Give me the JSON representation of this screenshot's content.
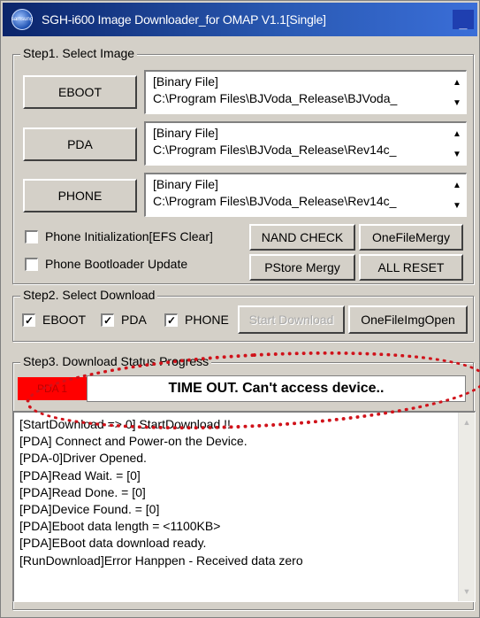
{
  "window": {
    "title": "SGH-i600 Image Downloader_for OMAP V1.1[Single]",
    "minimize_label": "_",
    "icon_text": "samsung"
  },
  "step1": {
    "title": "Step1. Select Image",
    "rows": [
      {
        "button": "EBOOT",
        "line1": "[Binary File]",
        "line2": "C:\\Program Files\\BJVoda_Release\\BJVoda_"
      },
      {
        "button": "PDA",
        "line1": "[Binary File]",
        "line2": "C:\\Program Files\\BJVoda_Release\\Rev14c_"
      },
      {
        "button": "PHONE",
        "line1": "[Binary File]",
        "line2": "C:\\Program Files\\BJVoda_Release\\Rev14c_"
      }
    ],
    "phone_init_label": "Phone Initialization[EFS Clear]",
    "phone_boot_label": "Phone Bootloader Update",
    "nand_check": "NAND CHECK",
    "onefile_mergy": "OneFileMergy",
    "pstore_mergy": "PStore Mergy",
    "all_reset": "ALL RESET"
  },
  "step2": {
    "title": "Step2. Select Download",
    "eboot": "EBOOT",
    "pda": "PDA",
    "phone": "PHONE",
    "check_mark": "✓",
    "start_download": "Start Download",
    "onefile_img_open": "OneFileImgOpen"
  },
  "step3": {
    "title": "Step3. Download Status Progress",
    "status_badge": "PDA 1",
    "status_message": "TIME OUT. Can't access device..",
    "log": [
      "[StartDownload => 0] StartDownload !!",
      "[PDA] Connect and Power-on the Device.",
      "[PDA-0]Driver Opened.",
      "[PDA]Read Wait. = [0]",
      "[PDA]Read Done. = [0]",
      "[PDA]Device Found. = [0]",
      "[PDA]Eboot data length = <1100KB>",
      "[PDA]EBoot data download ready.",
      "[RunDownload]Error Hanppen - Received data zero"
    ]
  },
  "colors": {
    "highlight": "#d0121a",
    "status_bg": "#ff0000"
  }
}
